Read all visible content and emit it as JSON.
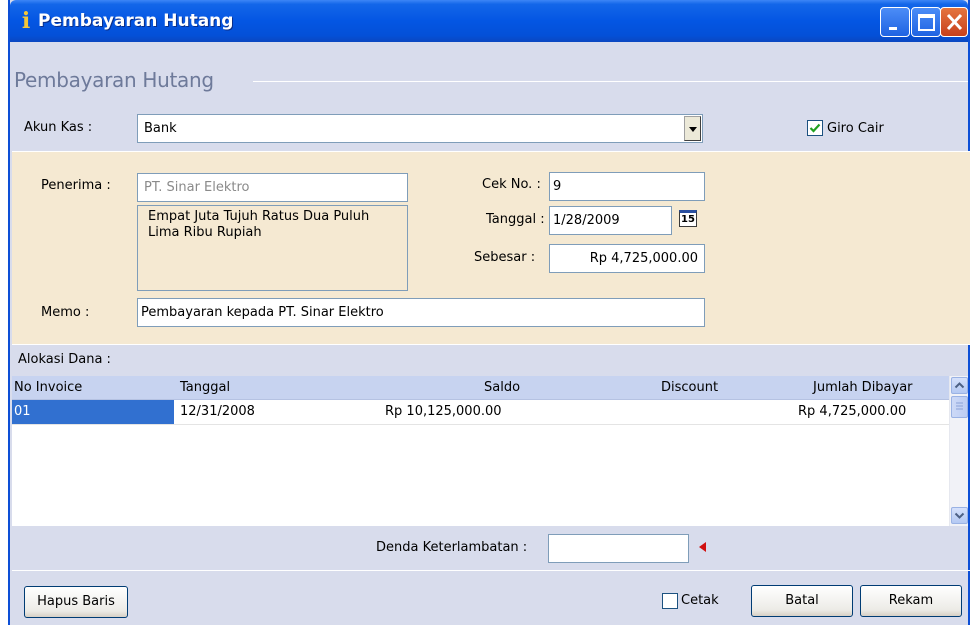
{
  "window": {
    "title": "Pembayaran Hutang",
    "accent_color": "#0456e3"
  },
  "form": {
    "group_title": "Pembayaran Hutang",
    "akun_kas_label": "Akun Kas :",
    "akun_kas_value": "Bank",
    "giro_cair_label": "Giro Cair",
    "giro_cair_checked": true,
    "penerima_label": "Penerima :",
    "penerima_value": "PT. Sinar Elektro",
    "terbilang": "Empat Juta Tujuh Ratus Dua Puluh Lima Ribu Rupiah",
    "cek_no_label": "Cek No. :",
    "cek_no_value": "9",
    "tanggal_label": "Tanggal :",
    "tanggal_value": "1/28/2009",
    "calendar_day": "15",
    "sebesar_label": "Sebesar :",
    "sebesar_value": "Rp 4,725,000.00",
    "memo_label": "Memo :",
    "memo_value": "Pembayaran kepada PT. Sinar Elektro"
  },
  "alokasi": {
    "label": "Alokasi Dana :",
    "columns": [
      "No Invoice",
      "Tanggal",
      "Saldo",
      "Discount",
      "Jumlah Dibayar"
    ],
    "rows": [
      {
        "no_invoice": "01",
        "tanggal": "12/31/2008",
        "saldo": "Rp 10,125,000.00",
        "discount": "",
        "jumlah_dibayar": "Rp 4,725,000.00"
      }
    ]
  },
  "denda": {
    "label": "Denda Keterlambatan :",
    "value": ""
  },
  "footer": {
    "hapus_baris": "Hapus Baris",
    "cetak_label": "Cetak",
    "cetak_checked": false,
    "batal": "Batal",
    "rekam": "Rekam"
  }
}
